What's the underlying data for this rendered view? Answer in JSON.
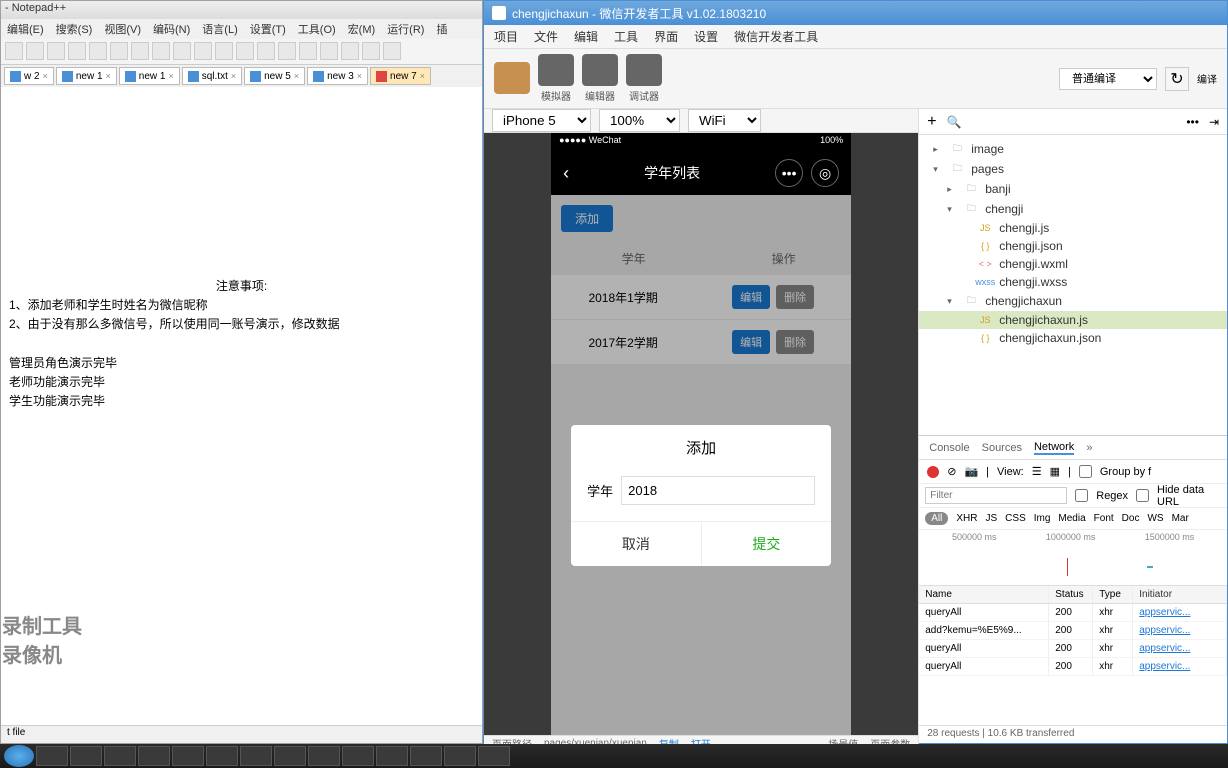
{
  "notepad": {
    "title": "- Notepad++",
    "menu": [
      "编辑(E)",
      "搜索(S)",
      "视图(V)",
      "编码(N)",
      "语言(L)",
      "设置(T)",
      "工具(O)",
      "宏(M)",
      "运行(R)",
      "插"
    ],
    "tabs": [
      {
        "label": "w 2",
        "active": false
      },
      {
        "label": "new 1",
        "active": false
      },
      {
        "label": "new 1",
        "active": false
      },
      {
        "label": "sql.txt",
        "active": false
      },
      {
        "label": "new 5",
        "active": false
      },
      {
        "label": "new 3",
        "active": false
      },
      {
        "label": "new 7",
        "active": true
      }
    ],
    "content": {
      "l1": "注意事项:",
      "l2": "1、添加老师和学生时姓名为微信昵称",
      "l3": "2、由于没有那么多微信号，所以使用同一账号演示，修改数据",
      "l4": "管理员角色演示完毕",
      "l5": "老师功能演示完毕",
      "l6": "学生功能演示完毕"
    },
    "status": "t file"
  },
  "wx": {
    "title": "chengjichaxun - 微信开发者工具 v1.02.1803210",
    "menu": [
      "项目",
      "文件",
      "编辑",
      "工具",
      "界面",
      "设置",
      "微信开发者工具"
    ],
    "tools": {
      "sim": "模拟器",
      "editor": "编辑器",
      "debug": "调试器"
    },
    "compile_select": "普通编译",
    "compile_label": "编译",
    "sim": {
      "device": "iPhone 5",
      "zoom": "100%",
      "network": "WiFi",
      "nav_title": "学年列表",
      "add_btn": "添加",
      "col1": "学年",
      "col2": "操作",
      "rows": [
        {
          "name": "2018年1学期",
          "edit": "编辑",
          "del": "删除"
        },
        {
          "name": "2017年2学期",
          "edit": "编辑",
          "del": "删除"
        }
      ],
      "modal": {
        "title": "添加",
        "label": "学年",
        "value": "2018",
        "cancel": "取消",
        "submit": "提交"
      },
      "footer": {
        "path_label": "页面路径",
        "path": "pages/xuenian/xuenian",
        "copy": "复制",
        "open": "打开",
        "scene": "场景值",
        "params": "页面参数"
      }
    },
    "tree": [
      {
        "t": "folder",
        "n": "image",
        "d": 0,
        "arr": "▸"
      },
      {
        "t": "folder",
        "n": "pages",
        "d": 0,
        "arr": "▾"
      },
      {
        "t": "folder",
        "n": "banji",
        "d": 1,
        "arr": "▸"
      },
      {
        "t": "folder",
        "n": "chengji",
        "d": 1,
        "arr": "▾"
      },
      {
        "t": "js",
        "n": "chengji.js",
        "d": 2,
        "ic": "JS"
      },
      {
        "t": "json",
        "n": "chengji.json",
        "d": 2,
        "ic": "{ }"
      },
      {
        "t": "wxml",
        "n": "chengji.wxml",
        "d": 2,
        "ic": "< >"
      },
      {
        "t": "wxss",
        "n": "chengji.wxss",
        "d": 2,
        "ic": "wxss"
      },
      {
        "t": "folder",
        "n": "chengjichaxun",
        "d": 1,
        "arr": "▾"
      },
      {
        "t": "js",
        "n": "chengjichaxun.js",
        "d": 2,
        "ic": "JS",
        "sel": true
      },
      {
        "t": "json",
        "n": "chengjichaxun.json",
        "d": 2,
        "ic": "{ }"
      }
    ],
    "devtools": {
      "tabs": [
        "Console",
        "Sources",
        "Network",
        "»"
      ],
      "active_tab": "Network",
      "view_label": "View:",
      "group_label": "Group by f",
      "filter_placeholder": "Filter",
      "regex": "Regex",
      "hide": "Hide data URL",
      "types": [
        "All",
        "XHR",
        "JS",
        "CSS",
        "Img",
        "Media",
        "Font",
        "Doc",
        "WS",
        "Mar"
      ],
      "timeline": [
        "500000 ms",
        "1000000 ms",
        "1500000 ms"
      ],
      "cols": {
        "name": "Name",
        "status": "Status",
        "type": "Type",
        "init": "Initiator"
      },
      "rows": [
        {
          "n": "queryAll",
          "s": "200",
          "t": "xhr",
          "i": "appservic..."
        },
        {
          "n": "add?kemu=%E5%9...",
          "s": "200",
          "t": "xhr",
          "i": "appservic..."
        },
        {
          "n": "queryAll",
          "s": "200",
          "t": "xhr",
          "i": "appservic..."
        },
        {
          "n": "queryAll",
          "s": "200",
          "t": "xhr",
          "i": "appservic..."
        }
      ],
      "footer": "28 requests | 10.6 KB transferred"
    }
  },
  "watermark": {
    "l1": "录制工具",
    "l2": "录像机"
  }
}
